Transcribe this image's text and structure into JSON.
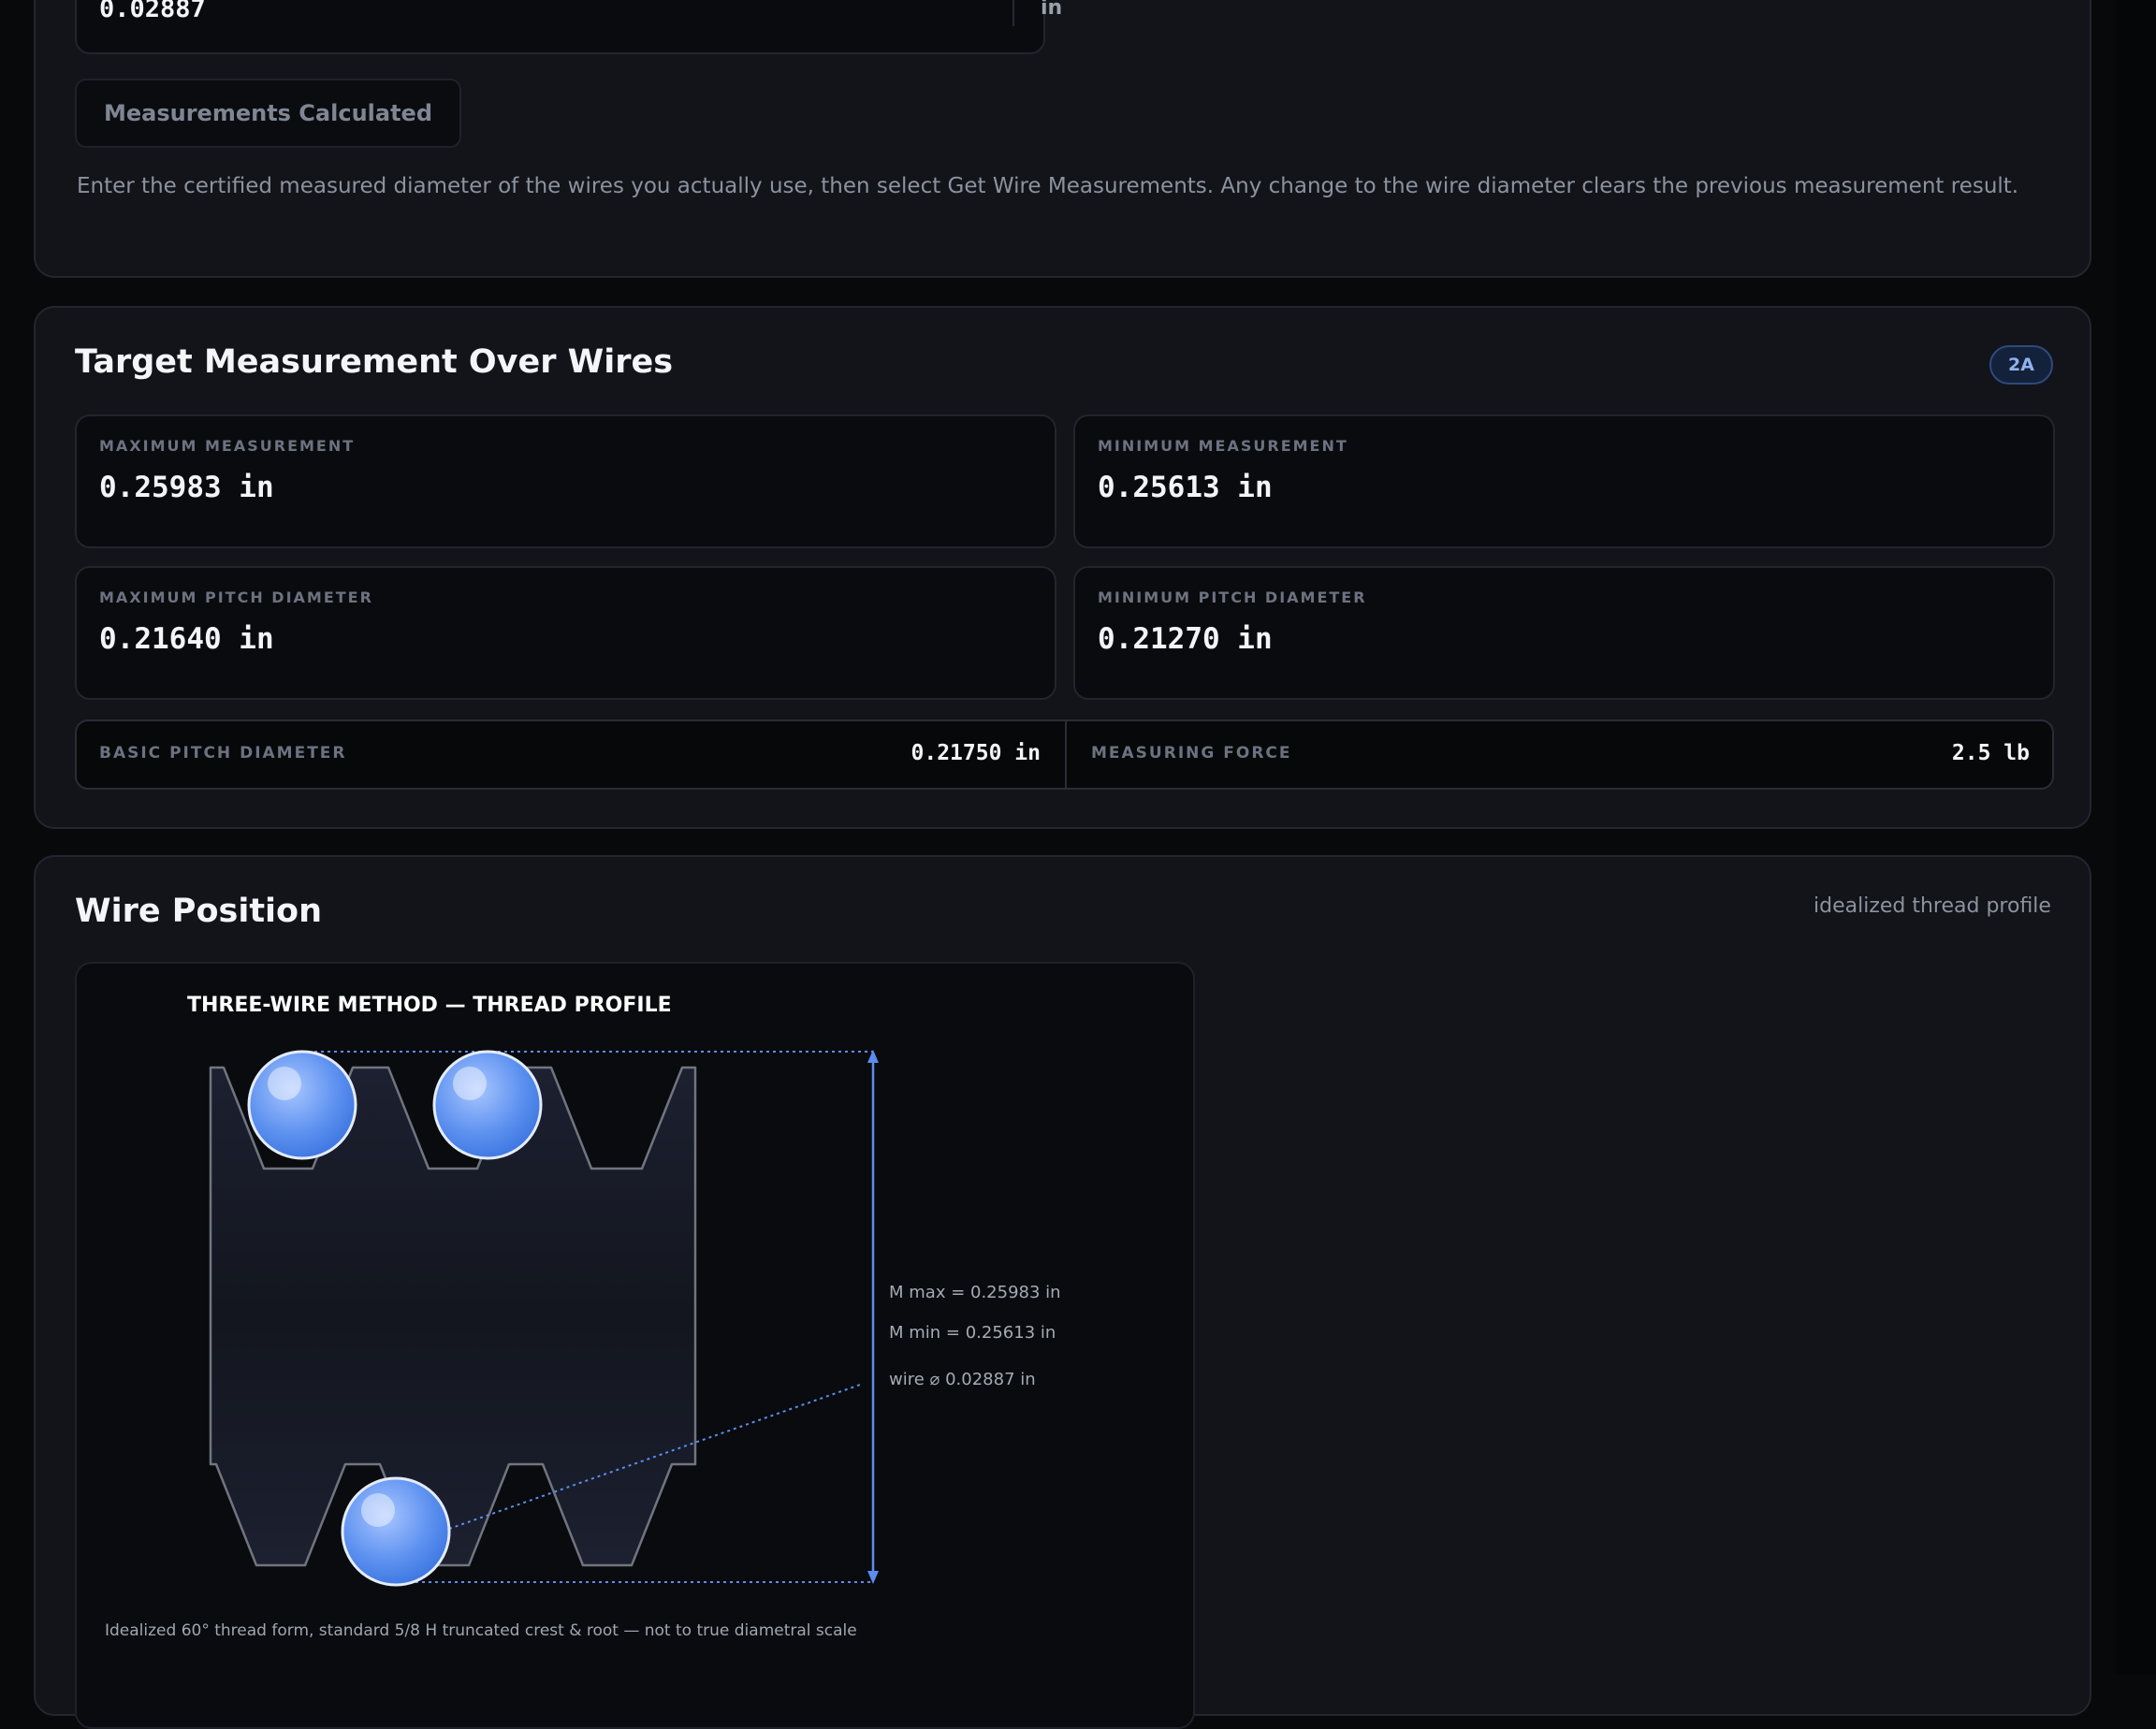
{
  "wire_input": {
    "value": "0.02887",
    "unit": "in",
    "button_label": "Measurements Calculated",
    "help_text": "Enter the certified measured diameter of the wires you actually use, then select Get Wire Measurements. Any change to the wire diameter clears the previous measurement result."
  },
  "target": {
    "title": "Target Measurement Over Wires",
    "badge": "2A",
    "max_measurement": {
      "label": "MAXIMUM MEASUREMENT",
      "value": "0.25983 in"
    },
    "min_measurement": {
      "label": "MINIMUM MEASUREMENT",
      "value": "0.25613 in"
    },
    "max_pitch": {
      "label": "MAXIMUM PITCH DIAMETER",
      "value": "0.21640 in"
    },
    "min_pitch": {
      "label": "MINIMUM PITCH DIAMETER",
      "value": "0.21270 in"
    },
    "basic_pitch": {
      "label": "BASIC PITCH DIAMETER",
      "value": "0.21750 in"
    },
    "measuring_force": {
      "label": "MEASURING FORCE",
      "value": "2.5 lb"
    }
  },
  "position": {
    "title": "Wire Position",
    "note": "idealized thread profile",
    "diagram": {
      "title": "THREE-WIRE METHOD — THREAD PROFILE",
      "m_max": "M max = 0.25983 in",
      "m_min": "M min = 0.25613 in",
      "wire_dia": "wire ⌀ 0.02887 in",
      "caption": "Idealized 60° thread form, standard 5/8 H truncated crest & root — not to true diametral scale"
    }
  },
  "colors": {
    "accent": "#5b8def",
    "background": "#08090b",
    "card": "#12141a",
    "badge_text": "#8fb3ef"
  }
}
